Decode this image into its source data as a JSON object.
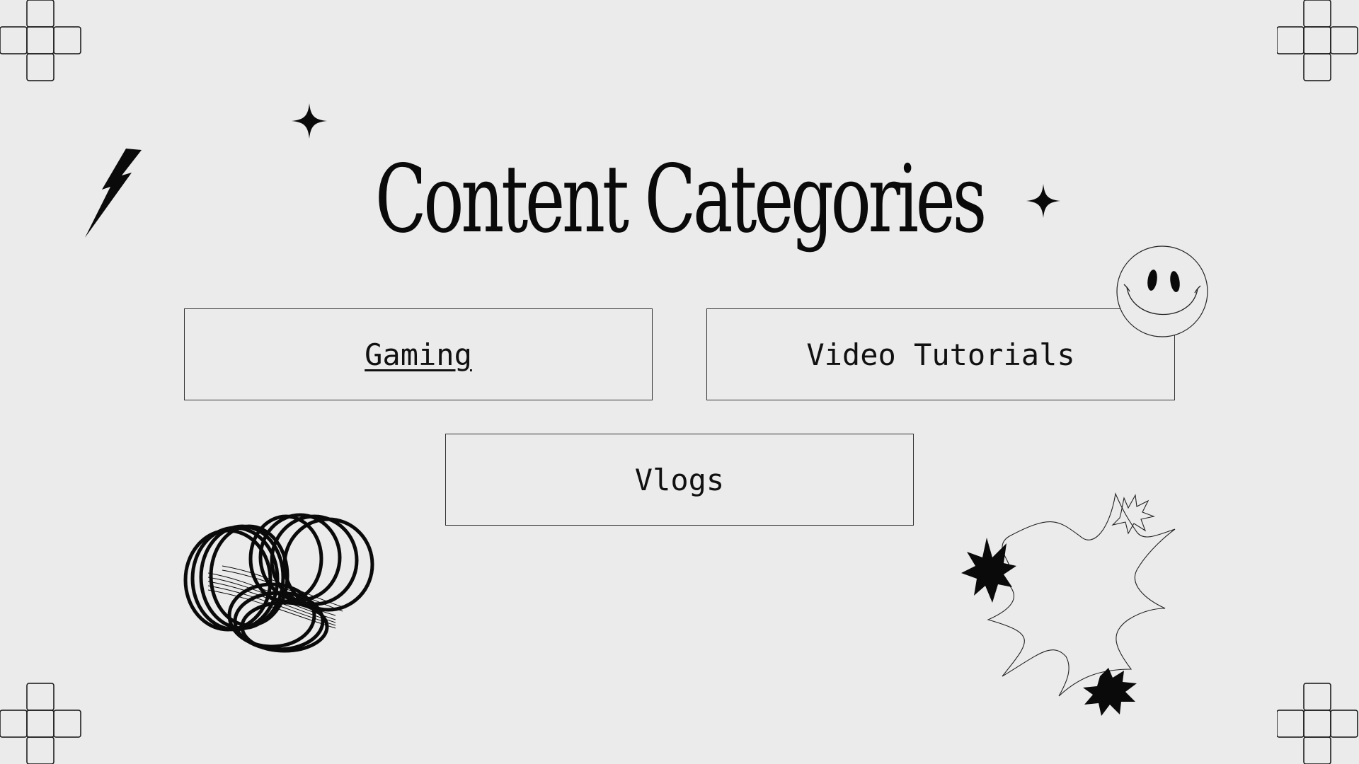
{
  "slide": {
    "title": "Content Categories"
  },
  "categories": [
    {
      "label": "Gaming",
      "linked": true
    },
    {
      "label": "Video Tutorials",
      "linked": false
    },
    {
      "label": "Vlogs",
      "linked": false
    }
  ],
  "decorations": {
    "icons": [
      "grid-cross-icon",
      "lightning-bolt-icon",
      "sparkle-icon",
      "smiley-face-icon",
      "spring-coil-icon",
      "burst-star-icon"
    ]
  },
  "colors": {
    "background": "#ebebeb",
    "ink": "#111111"
  }
}
